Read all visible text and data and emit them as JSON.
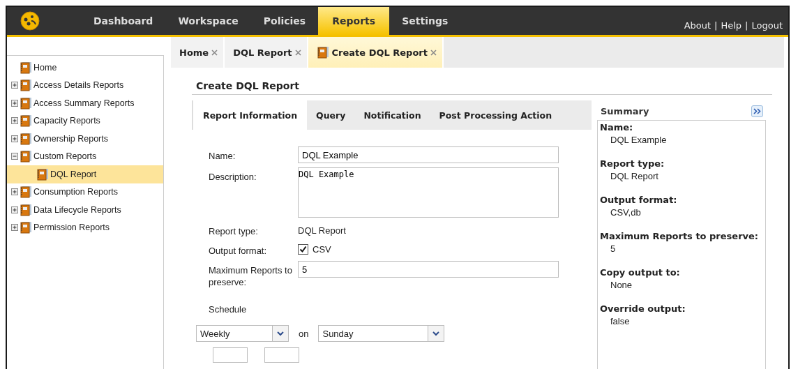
{
  "nav": {
    "items": [
      {
        "label": "Dashboard",
        "selected": false
      },
      {
        "label": "Workspace",
        "selected": false
      },
      {
        "label": "Policies",
        "selected": false
      },
      {
        "label": "Reports",
        "selected": true
      },
      {
        "label": "Settings",
        "selected": false
      }
    ],
    "links": [
      "About",
      "Help",
      "Logout"
    ],
    "link_separator": "|"
  },
  "sidebar": {
    "items": [
      {
        "label": "Home",
        "selected": false
      },
      {
        "label": "Access Details Reports",
        "selected": false,
        "expanded": false
      },
      {
        "label": "Access Summary Reports",
        "selected": false,
        "expanded": false
      },
      {
        "label": "Capacity Reports",
        "selected": false,
        "expanded": false
      },
      {
        "label": "Ownership Reports",
        "selected": false,
        "expanded": false
      },
      {
        "label": "Custom Reports",
        "selected": false,
        "expanded": true,
        "children": [
          {
            "label": "DQL Report",
            "selected": true
          }
        ]
      },
      {
        "label": "Consumption Reports",
        "selected": false,
        "expanded": false
      },
      {
        "label": "Data Lifecycle Reports",
        "selected": false,
        "expanded": false
      },
      {
        "label": "Permission Reports",
        "selected": false,
        "expanded": false
      }
    ]
  },
  "tabs": [
    {
      "label": "Home",
      "selected": false
    },
    {
      "label": "DQL Report",
      "selected": false
    },
    {
      "label": "Create DQL Report",
      "selected": true
    }
  ],
  "page_title": "Create DQL Report",
  "form_tabs": [
    {
      "label": "Report Information",
      "selected": true
    },
    {
      "label": "Query",
      "selected": false
    },
    {
      "label": "Notification",
      "selected": false
    },
    {
      "label": "Post Processing Action",
      "selected": false
    }
  ],
  "form": {
    "name": {
      "label": "Name:",
      "value": "DQL Example"
    },
    "description": {
      "label": "Description:",
      "value": "DQL Example"
    },
    "report_type": {
      "label": "Report type:",
      "value": "DQL Report"
    },
    "output_format": {
      "label": "Output format:",
      "option": "CSV",
      "checked": true
    },
    "max_reports": {
      "label": "Maximum Reports to preserve:",
      "value": "5"
    },
    "schedule": {
      "label": "Schedule",
      "frequency": "Weekly",
      "on_label": "on",
      "day": "Sunday"
    }
  },
  "summary": {
    "title": "Summary",
    "entries": [
      {
        "label": "Name:",
        "value": "DQL Example"
      },
      {
        "label": "Report type:",
        "value": "DQL Report"
      },
      {
        "label": "Output format:",
        "value": "CSV,db"
      },
      {
        "label": "Maximum Reports to preserve:",
        "value": "5"
      },
      {
        "label": "Copy output to:",
        "value": "None"
      },
      {
        "label": "Override output:",
        "value": "false"
      }
    ]
  }
}
